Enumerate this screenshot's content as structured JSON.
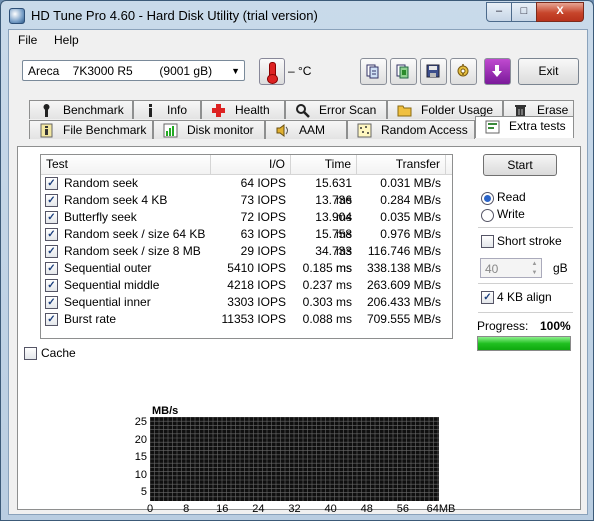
{
  "window": {
    "title": "HD Tune Pro 4.60 - Hard Disk Utility (trial version)",
    "min_glyph": "–",
    "max_glyph": "□",
    "close_glyph": "X"
  },
  "menu": [
    "File",
    "Help"
  ],
  "toolbar": {
    "drive": "Areca    7K3000 R5        (9001 gB)",
    "temperature": "– °C",
    "exit_label": "Exit",
    "icons": [
      "copy-info-icon",
      "copy-screen-icon",
      "save-icon",
      "options-icon",
      "download-icon"
    ]
  },
  "tabs": {
    "row1": [
      "Benchmark",
      "Info",
      "Health",
      "Error Scan",
      "Folder Usage",
      "Erase"
    ],
    "row2": [
      "File Benchmark",
      "Disk monitor",
      "AAM",
      "Random Access",
      "Extra tests"
    ],
    "active": "Extra tests"
  },
  "table": {
    "columns": [
      "Test",
      "I/O",
      "Time",
      "Transfer"
    ],
    "rows": [
      {
        "test": "Random seek",
        "io": "64 IOPS",
        "time": "15.631 ms",
        "transfer": "0.031 MB/s"
      },
      {
        "test": "Random seek 4 KB",
        "io": "73 IOPS",
        "time": "13.736 ms",
        "transfer": "0.284 MB/s"
      },
      {
        "test": "Butterfly seek",
        "io": "72 IOPS",
        "time": "13.904 ms",
        "transfer": "0.035 MB/s"
      },
      {
        "test": "Random seek / size 64 KB",
        "io": "63 IOPS",
        "time": "15.758 ms",
        "transfer": "0.976 MB/s"
      },
      {
        "test": "Random seek / size 8 MB",
        "io": "29 IOPS",
        "time": "34.733 ms",
        "transfer": "116.746 MB/s"
      },
      {
        "test": "Sequential outer",
        "io": "5410 IOPS",
        "time": "0.185 ms",
        "transfer": "338.138 MB/s"
      },
      {
        "test": "Sequential middle",
        "io": "4218 IOPS",
        "time": "0.237 ms",
        "transfer": "263.609 MB/s"
      },
      {
        "test": "Sequential inner",
        "io": "3303 IOPS",
        "time": "0.303 ms",
        "transfer": "206.433 MB/s"
      },
      {
        "test": "Burst rate",
        "io": "11353 IOPS",
        "time": "0.088 ms",
        "transfer": "709.555 MB/s"
      }
    ],
    "check_glyph": "✓"
  },
  "cache_label": "Cache",
  "controls": {
    "start_label": "Start",
    "read_label": "Read",
    "write_label": "Write",
    "mode": "Read",
    "short_stroke_label": "Short stroke",
    "short_stroke_checked": false,
    "short_stroke_value": "40",
    "short_stroke_unit": "gB",
    "align_label": "4 KB align",
    "align_checked": true,
    "progress_label": "Progress:",
    "progress_value": "100%",
    "progress_fraction": 1.0
  },
  "graph": {
    "unit_label": "MB/s",
    "y_ticks": [
      "25",
      "20",
      "15",
      "10",
      "5"
    ],
    "x_ticks": [
      "0",
      "8",
      "16",
      "24",
      "32",
      "40",
      "48",
      "56",
      "64MB"
    ],
    "colors": {
      "background": "#0f0f0f",
      "grid": "#6a6a6a"
    }
  }
}
